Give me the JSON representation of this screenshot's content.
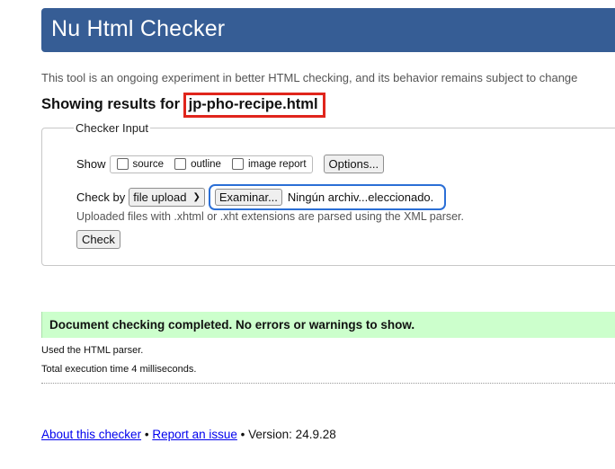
{
  "header": {
    "title": "Nu Html Checker"
  },
  "intro": "This tool is an ongoing experiment in better HTML checking, and its behavior remains subject to change",
  "results": {
    "prefix": "Showing results for",
    "document": "jp-pho-recipe.html"
  },
  "checker_input": {
    "legend": "Checker Input",
    "show_label": "Show",
    "show_options": [
      {
        "label": "source",
        "checked": false
      },
      {
        "label": "outline",
        "checked": false
      },
      {
        "label": "image report",
        "checked": false
      }
    ],
    "options_button": "Options...",
    "check_by_label": "Check by",
    "check_by_value": "file upload",
    "browse_button": "Examinar...",
    "file_name": "Ningún archiv...eleccionado.",
    "hint": "Uploaded files with .xhtml or .xht extensions are parsed using the XML parser.",
    "check_button": "Check"
  },
  "status": {
    "message": "Document checking completed. No errors or warnings to show.",
    "parser_note": "Used the HTML parser.",
    "timing_note": "Total execution time 4 milliseconds."
  },
  "footer": {
    "about_link": "About this checker",
    "sep1": "•",
    "report_link": "Report an issue",
    "sep2": "•",
    "version": "Version: 24.9.28"
  },
  "colors": {
    "banner": "#365d95",
    "success_bg": "#ccffcc",
    "highlight_border": "#e0251c",
    "focus_ring": "#2b6fd6",
    "link": "#0000ee"
  }
}
